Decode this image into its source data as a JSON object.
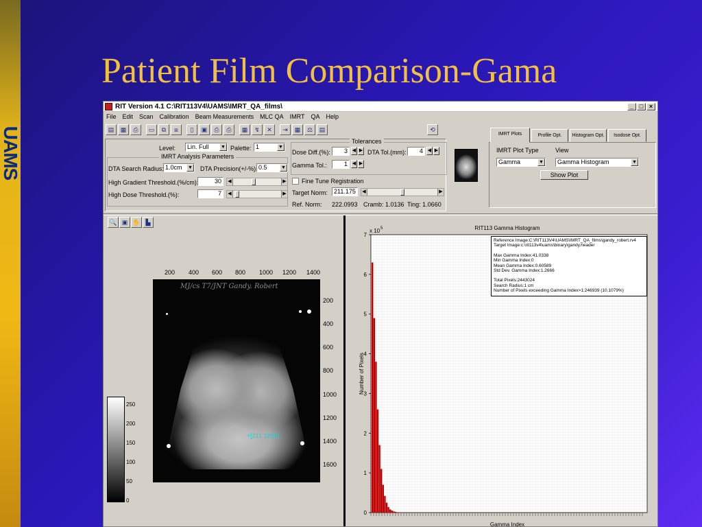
{
  "slide": {
    "title": "Patient Film Comparison-Gama",
    "brand": "UAMS"
  },
  "window": {
    "title": "RIT Version 4.1 C:\\RIT113V4\\UAMS\\IMRT_QA_films\\",
    "controls": {
      "minimize": "_",
      "maximize": "□",
      "close": "×"
    }
  },
  "menu": [
    "File",
    "Edit",
    "Scan",
    "Calibration",
    "Beam Measurements",
    "MLC QA",
    "IMRT",
    "QA",
    "Help"
  ],
  "toolbar": {
    "icons": [
      "open-icon",
      "save-as-icon",
      "print-icon",
      "disk-icon",
      "copy-icon",
      "compare-icon",
      "document-icon",
      "report-icon",
      "printer-icon",
      "printer2-icon",
      "calendar-icon",
      "measure-icon",
      "erase-icon",
      "align-icon",
      "grid-icon",
      "scale-icon",
      "table-icon",
      "undo-icon"
    ]
  },
  "settings": {
    "level_label": "Level:",
    "level_value": "Lin. Full",
    "palette_label": "Palette:",
    "palette_value": "1",
    "imrt_group_title": "IMRT Analysis Parameters",
    "dta_radius_label": "DTA Search Radius:",
    "dta_radius_value": "1.0cm",
    "dta_precision_label": "DTA Precision(+/-%):",
    "dta_precision_value": "0.5",
    "high_gradient_label": "High Gradient Threshold.(%/cm):",
    "high_gradient_value": "30",
    "high_gradient_level": 0.42,
    "high_dose_label": "High Dose Threshold.(%):",
    "high_dose_value": "7",
    "high_dose_level": 0.05
  },
  "tolerances": {
    "title": "Tolerances",
    "dose_diff_label": "Dose Diff.(%):",
    "dose_diff_value": "3",
    "dta_tol_label": "DTA Tol.(mm):",
    "dta_tol_value": "4",
    "gamma_tol_label": "Gamma Tol.:",
    "gamma_tol_value": "1",
    "fine_tune_label": "Fine Tune Registration",
    "fine_tune_checked": false,
    "target_norm_label": "Target Norm:",
    "target_norm_value": "211.175",
    "target_norm_level": 0.5,
    "ref_norm_label": "Ref. Norm:",
    "ref_norm_value": "222.0993",
    "cramb_label": "Cramb: 1.0136",
    "ting_label": "Ting:  1.0660"
  },
  "tabs": {
    "items": [
      "IMRT Plots",
      "Profile Opt.",
      "Histogram Opt.",
      "Isodose Opt."
    ],
    "active": 0
  },
  "imrt_plots": {
    "plot_type_label": "IMRT Plot Type",
    "view_label": "View",
    "plot_type_value": "Gamma",
    "view_value": "Gamma Histogram",
    "show_plot_label": "Show Plot"
  },
  "image_view": {
    "tools": [
      "zoom-icon",
      "window-icon",
      "hand-icon",
      "ruler-icon"
    ],
    "x_ticks": [
      "200",
      "400",
      "600",
      "800",
      "1000",
      "1200",
      "1400"
    ],
    "y_ticks": [
      "200",
      "400",
      "600",
      "800",
      "1000",
      "1200",
      "1400",
      "1600"
    ],
    "film_annotation": "MJ/cs  T7/JNT Gandy. Robert",
    "cursor_readout": "+[211.1850]",
    "colorbar_ticks": [
      "250",
      "200",
      "150",
      "100",
      "50",
      "0"
    ]
  },
  "chart_data": {
    "type": "bar",
    "title": "RIT113 Gamma Histogram",
    "ylabel": "Number of Pixels",
    "xlabel": "Gamma Index",
    "y_multiplier_label": "x 10",
    "y_multiplier_exp": "5",
    "ylim": [
      0,
      7
    ],
    "y_ticks": [
      "0",
      "1",
      "2",
      "3",
      "4",
      "5",
      "6",
      "7"
    ],
    "grid": true,
    "bar_color": "#c00000",
    "bins_x": [
      0.1,
      0.2,
      0.3,
      0.4,
      0.5,
      0.6,
      0.7,
      0.8,
      0.9,
      1.0,
      1.1,
      1.2,
      1.3,
      1.4,
      1.5
    ],
    "values": [
      6.3,
      4.9,
      3.8,
      2.6,
      1.7,
      1.1,
      0.7,
      0.42,
      0.25,
      0.14,
      0.08,
      0.05,
      0.03,
      0.02,
      0.01
    ],
    "info": {
      "reference_image": "Reference Image:C:\\RIT113V4\\UAMS\\IMRT_QA_films\\gandy_robert.rv4",
      "target_image": "Target Image:c:\\rit113v4\\uams\\binary\\gandy.header",
      "max_gamma": "Max Gamma Index:41.0338",
      "min_gamma": "Min Gamma Index:0",
      "mean_gamma": "Mean Gamma Index:0.60589",
      "std_gamma": "Std Dev. Gamma Index:1.2666",
      "total_pixels": "Total Pixels:2443024",
      "search_radius": "Search Radius:1 cm",
      "exceeding": "Number of Pixels exceeding Gamma Index>1:246939 (10.1079%)"
    }
  }
}
